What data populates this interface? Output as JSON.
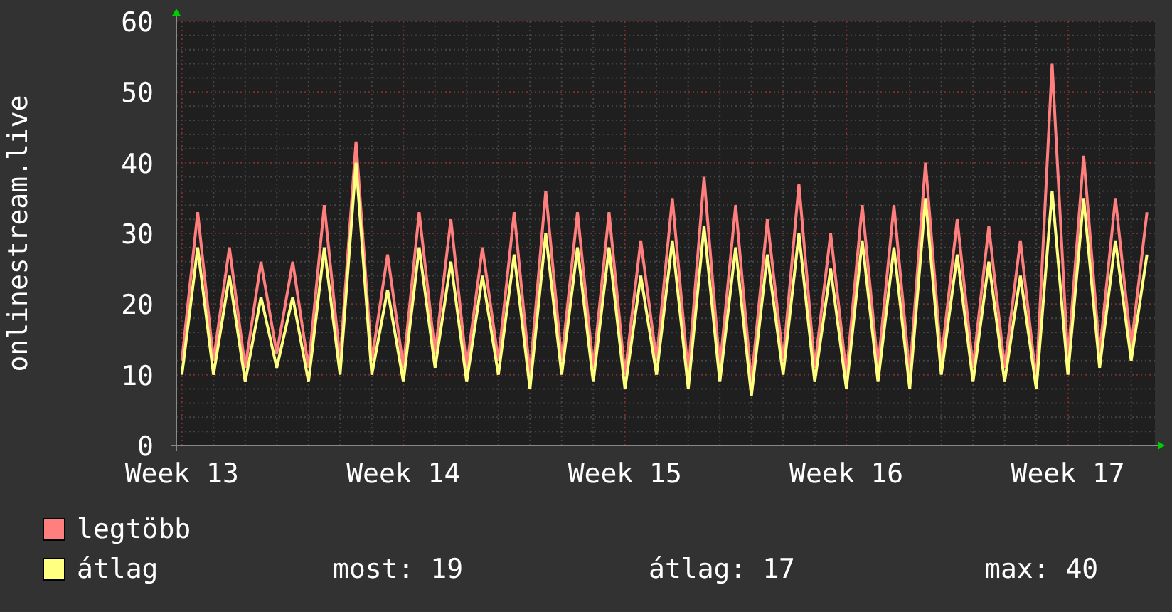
{
  "chart": {
    "chart_data": {
      "type": "line",
      "ylabel": "onlinestream.live",
      "categories": [
        "Week 13",
        null,
        null,
        null,
        null,
        null,
        null,
        null,
        null,
        null,
        null,
        null,
        null,
        null,
        "Week 14",
        null,
        null,
        null,
        null,
        null,
        null,
        null,
        null,
        null,
        null,
        null,
        null,
        null,
        "Week 15",
        null,
        null,
        null,
        null,
        null,
        null,
        null,
        null,
        null,
        null,
        null,
        null,
        null,
        "Week 16",
        null,
        null,
        null,
        null,
        null,
        null,
        null,
        null,
        null,
        null,
        null,
        null,
        null,
        "Week 17",
        null,
        null,
        null,
        null,
        null
      ],
      "ylim": [
        0,
        60
      ],
      "grid": true,
      "yticks": [
        0,
        10,
        20,
        30,
        40,
        50,
        60
      ],
      "series": [
        {
          "name": "legtöbb",
          "color": "#ff7f7f",
          "values": [
            12,
            33,
            12,
            28,
            11,
            26,
            13,
            26,
            11,
            34,
            12,
            43,
            12,
            27,
            11,
            33,
            13,
            32,
            11,
            28,
            12,
            33,
            10,
            36,
            12,
            33,
            11,
            33,
            10,
            29,
            12,
            35,
            10,
            38,
            11,
            34,
            9,
            32,
            12,
            37,
            11,
            30,
            10,
            34,
            11,
            34,
            10,
            40,
            12,
            32,
            11,
            31,
            11,
            29,
            9,
            54,
            12,
            41,
            13,
            35,
            14,
            33
          ]
        },
        {
          "name": "átlag",
          "color": "#ffff80",
          "values": [
            10,
            28,
            10,
            24,
            9,
            21,
            11,
            21,
            9,
            28,
            10,
            40,
            10,
            22,
            9,
            28,
            11,
            26,
            9,
            24,
            10,
            27,
            8,
            30,
            10,
            28,
            9,
            28,
            8,
            24,
            10,
            29,
            8,
            31,
            9,
            28,
            7,
            27,
            10,
            30,
            9,
            25,
            8,
            29,
            9,
            28,
            8,
            35,
            10,
            27,
            9,
            26,
            9,
            24,
            8,
            36,
            10,
            35,
            11,
            29,
            12,
            27
          ]
        }
      ]
    }
  },
  "legend": {
    "stats": [
      "most: 19",
      "átlag: 17",
      "max: 40"
    ]
  }
}
